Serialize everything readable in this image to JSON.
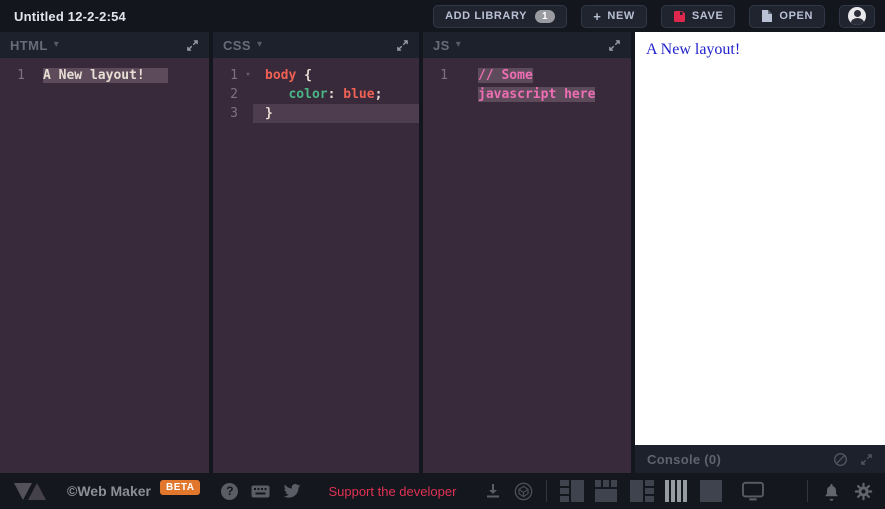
{
  "topbar": {
    "title": "Untitled 12-2-2:54",
    "buttons": {
      "add_library": {
        "label": "ADD LIBRARY",
        "count": "1"
      },
      "new": {
        "label": "NEW"
      },
      "save": {
        "label": "SAVE"
      },
      "open": {
        "label": "OPEN"
      }
    }
  },
  "panes": [
    {
      "id": "html",
      "title": "HTML",
      "rows": [
        {
          "num": "1",
          "tokens": [
            {
              "text": "A New layout!",
              "color": "plain",
              "selected": true
            },
            {
              "text": "   ",
              "color": "plain",
              "selected": true
            }
          ]
        }
      ]
    },
    {
      "id": "css",
      "title": "CSS",
      "rows": [
        {
          "num": "1",
          "fold": true,
          "tokens": [
            {
              "text": "body",
              "color": "red"
            },
            {
              "text": " {",
              "color": "plain"
            }
          ]
        },
        {
          "num": "2",
          "tokens": [
            {
              "text": "   ",
              "color": "plain"
            },
            {
              "text": "color",
              "color": "green"
            },
            {
              "text": ": ",
              "color": "plain"
            },
            {
              "text": "blue",
              "color": "red"
            },
            {
              "text": ";",
              "color": "plain"
            }
          ]
        },
        {
          "num": "3",
          "active_line": true,
          "tokens": [
            {
              "text": "}",
              "color": "plain"
            }
          ]
        }
      ]
    },
    {
      "id": "js",
      "title": "JS",
      "rows": [
        {
          "num": "1",
          "tokens": [
            {
              "text": "// Some",
              "color": "comment",
              "selected": true
            }
          ]
        },
        {
          "num": "",
          "tokens": [
            {
              "text": "javascript here",
              "color": "comment",
              "selected": true
            }
          ]
        }
      ]
    }
  ],
  "preview": {
    "text": "A New layout!"
  },
  "console": {
    "label": "Console (0)"
  },
  "footer": {
    "brand": "©Web Maker",
    "beta_badge": "BETA",
    "support_link": "Support the developer"
  },
  "icons": {
    "caret_down": "▾",
    "fold_caret": "▾",
    "plus": "+",
    "question_mark": "?"
  },
  "colors": {
    "topbar_bg": "#14161d",
    "pane_header_bg": "#1d212b",
    "editor_bg": "#382a3a",
    "selection_bg": "#5d4b5c",
    "active_line_bg": "#4e3d4f",
    "syntax_red": "#ef6155",
    "syntax_green": "#48b685",
    "syntax_pink": "#ef6eb3",
    "syntax_plain": "#e6ddd3",
    "save_icon_red": "#e0284f",
    "beta_orange": "#e1772c",
    "support_red": "#e13254",
    "preview_text_blue": "#2222cc"
  }
}
